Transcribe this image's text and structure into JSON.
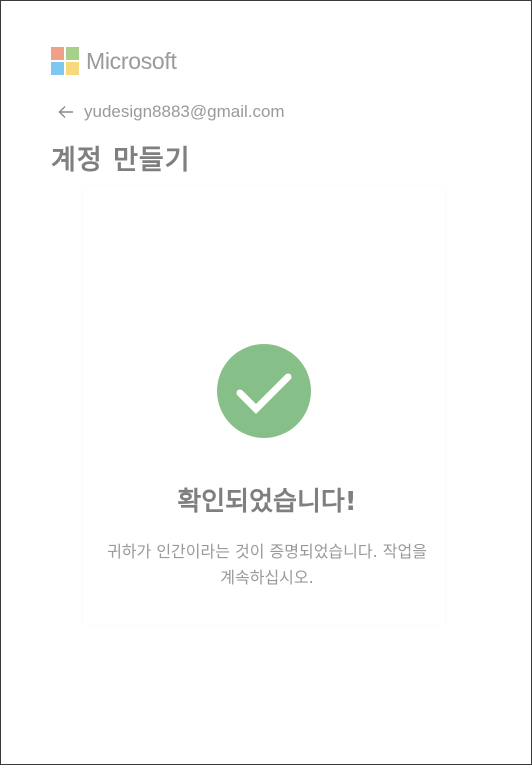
{
  "brand": {
    "name": "Microsoft",
    "logo_colors": [
      "#f0a089",
      "#a6d08c",
      "#7fc7f0",
      "#f7d87a"
    ]
  },
  "account": {
    "email": "yudesign8883@gmail.com",
    "back_icon": "back-arrow-icon"
  },
  "page": {
    "title": "계정 만들기"
  },
  "verification": {
    "icon": "checkmark-icon",
    "icon_color": "#86bf88",
    "title": "확인되었습니다!",
    "message": "귀하가 인간이라는 것이 증명되었습니다. 작업을 계속하십시오."
  }
}
